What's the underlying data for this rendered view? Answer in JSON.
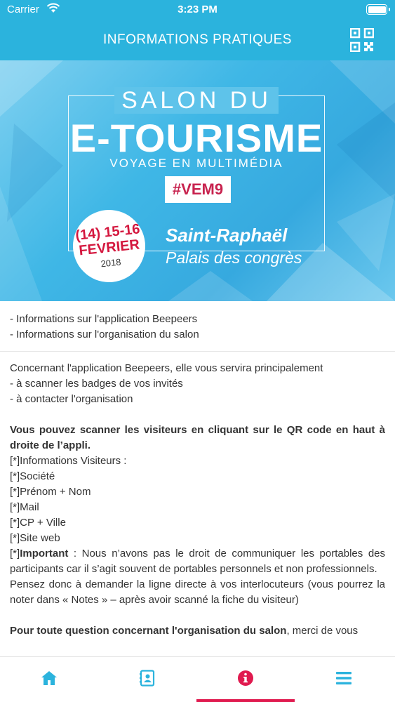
{
  "status_bar": {
    "carrier": "Carrier",
    "time": "3:23 PM",
    "icons": [
      "wifi-icon",
      "battery-icon"
    ]
  },
  "header": {
    "title": "INFORMATIONS PRATIQUES",
    "qr_icon": "qr-code-icon"
  },
  "banner": {
    "line1": "SALON DU",
    "line2": "E-TOURISME",
    "line3": "VOYAGE EN MULTIMÉDIA",
    "hashtag": "#VEM9",
    "dates_line1": "(14) 15-16",
    "dates_line2": "FEVRIER",
    "year": "2018",
    "city": "Saint-Raphaël",
    "venue": "Palais des congrès"
  },
  "links": [
    "- Informations sur l'application Beepeers",
    "- Informations sur l'organisation du salon"
  ],
  "content": {
    "intro": "Concernant l'application Beepeers, elle vous servira principalement",
    "bullet1": "- à scanner les badges de vos invités",
    "bullet2": "- à contacter l'organisation",
    "scan_bold": "Vous pouvez scanner les visiteurs en cliquant sur le QR code en haut à droite de l’appli.",
    "fields": [
      "[*]Informations Visiteurs :",
      "[*]Société",
      "[*]Prénom + Nom",
      "[*]Mail",
      "[*]CP + Ville",
      "[*]Site web"
    ],
    "important_prefix": "[*]",
    "important_label": "Important",
    "important_text": " : Nous n’avons pas le droit de communiquer les portables des participants car il s’agit souvent de portables personnels et non professionnels.",
    "think_text": "Pensez donc à demander la ligne directe à vos interlocuteurs (vous pourrez la noter dans « Notes » – après avoir scanné la fiche du visiteur)",
    "question_bold": "Pour toute question concernant l'organisation du salon",
    "question_rest": ", merci de vous"
  },
  "tabs": [
    {
      "icon": "home-icon",
      "active": false
    },
    {
      "icon": "contacts-icon",
      "active": false
    },
    {
      "icon": "info-icon",
      "active": true
    },
    {
      "icon": "menu-icon",
      "active": false
    }
  ],
  "colors": {
    "primary": "#2bb3dd",
    "accent": "#e01a4f",
    "tab_icon": "#2bb3dd"
  }
}
